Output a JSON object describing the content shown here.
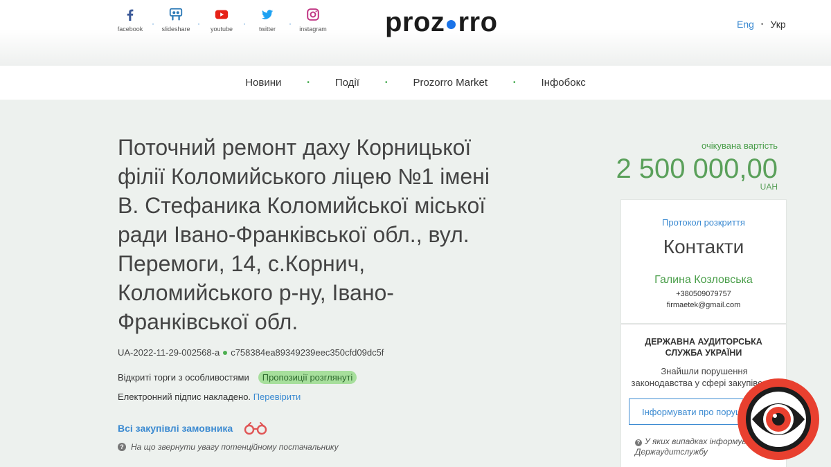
{
  "header": {
    "social": [
      {
        "label": "facebook",
        "icon": "facebook-icon",
        "color": "#3b5998"
      },
      {
        "label": "slideshare",
        "icon": "slideshare-icon",
        "color": "#2e7bb7"
      },
      {
        "label": "youtube",
        "icon": "youtube-icon",
        "color": "#e62117"
      },
      {
        "label": "twitter",
        "icon": "twitter-icon",
        "color": "#1da1f2"
      },
      {
        "label": "instagram",
        "icon": "instagram-icon",
        "color": "#c13584"
      }
    ],
    "logo_left": "proz",
    "logo_right": "rro",
    "lang_eng": "Eng",
    "lang_ukr": "Укр"
  },
  "nav": {
    "items": [
      "Новини",
      "Події",
      "Prozorro Market",
      "Інфобокс"
    ]
  },
  "tender": {
    "title": "Поточний ремонт даху Корницької філії Коломийського ліцею №1 імені В. Стефаника Коломийської міської ради Івано-Франківської обл., вул. Перемоги, 14, с.Корнич, Коломийського р-ну, Івано-Франківської обл.",
    "id": "UA-2022-11-29-002568-a",
    "hash": "c758384ea89349239eec350cfd09dc5f",
    "procedure": "Відкриті торги з особливостями",
    "status": "Пропозиції розглянуті",
    "signature_text": "Електронний підпис накладено.",
    "verify_link": "Перевірити",
    "all_purchases": "Всі закупівлі замовника",
    "supplier_note": "На що звернути увагу потенційному постачальнику"
  },
  "value": {
    "label": "очікувана вартість",
    "amount": "2 500 000,00",
    "currency": "UAH"
  },
  "contacts": {
    "protocol_link": "Протокол розкриття",
    "title": "Контакти",
    "name": "Галина Козловська",
    "phone": "+380509079757",
    "email": "firmaetek@gmail.com"
  },
  "audit": {
    "title_line1": "ДЕРЖАВНА АУДИТОРСЬКА",
    "title_line2": "СЛУЖБА УКРАЇНИ",
    "text_line1": "Знайшли порушення",
    "text_line2": "законодавства у сфері закупівель?",
    "button": "Інформувати про порушення",
    "note_line1": "У яких випадках інформувати",
    "note_line2": "Держаудитслужбу"
  },
  "colors": {
    "accent_blue": "#3b8ad1",
    "accent_green": "#5aa05a",
    "status_badge": "#a7df9c"
  }
}
